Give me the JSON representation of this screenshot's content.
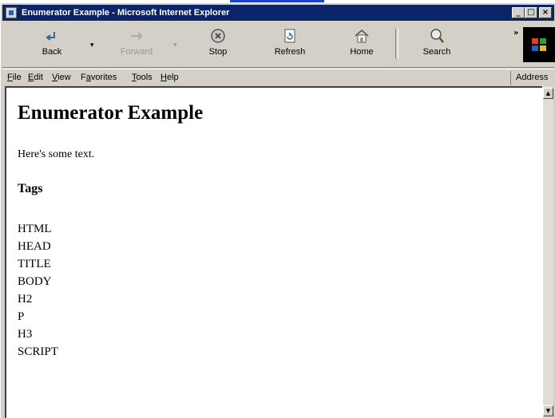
{
  "window": {
    "title": "Enumerator Example - Microsoft Internet Explorer",
    "controls": {
      "minimize": "_",
      "maximize": "□",
      "close": "×"
    }
  },
  "toolbar": {
    "back_label": "Back",
    "forward_label": "Forward",
    "stop_label": "Stop",
    "refresh_label": "Refresh",
    "home_label": "Home",
    "search_label": "Search",
    "dropdown_glyph": "▾",
    "overflow_glyph": "»"
  },
  "menu": {
    "file": {
      "u": "F",
      "rest": "ile"
    },
    "edit": {
      "u": "E",
      "rest": "dit"
    },
    "view": {
      "u": "V",
      "rest": "iew"
    },
    "favorites": {
      "pre": "F",
      "u": "a",
      "rest": "vorites"
    },
    "tools": {
      "u": "T",
      "rest": "ools"
    },
    "help": {
      "u": "H",
      "rest": "elp"
    },
    "address_label": "Address"
  },
  "page": {
    "heading": "Enumerator Example",
    "text": "Here's some text.",
    "tags_heading": "Tags",
    "tags": [
      "HTML",
      "HEAD",
      "TITLE",
      "BODY",
      "H2",
      "P",
      "H3",
      "SCRIPT"
    ]
  },
  "scrollbar": {
    "up_glyph": "▲",
    "down_glyph": "▼"
  },
  "colors": {
    "titlebar": "#0a246a",
    "chrome": "#d4d0c8",
    "link_strip": "#1c3fd0"
  }
}
